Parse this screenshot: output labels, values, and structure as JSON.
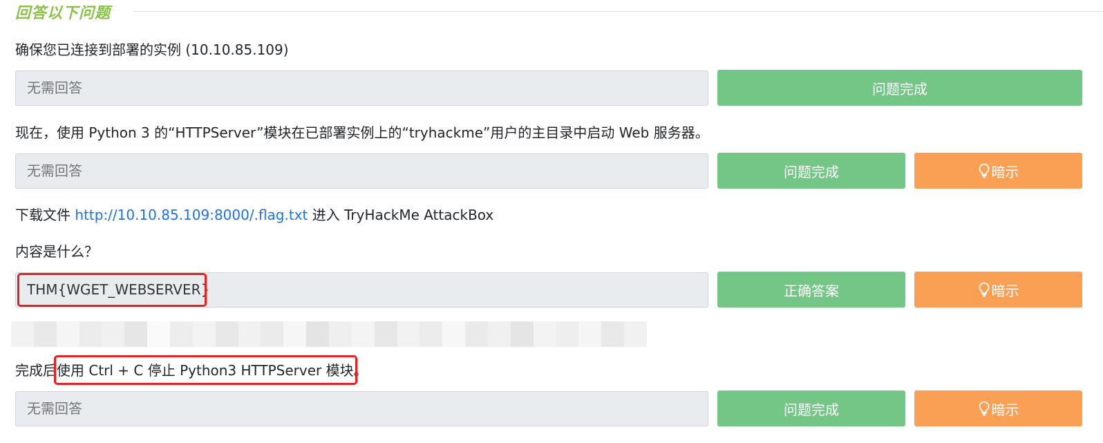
{
  "section": {
    "title": "回答以下问题"
  },
  "questions": [
    {
      "text": "确保您已连接到部署的实例 (10.10.85.109)",
      "answer": "无需回答",
      "button": "问题完成"
    },
    {
      "text": "现在，使用 Python 3 的“HTTPServer”模块在已部署实例上的“tryhackme”用户的主目录中启动 Web 服务器。",
      "answer": "无需回答",
      "button": "问题完成",
      "hint": "暗示"
    },
    {
      "text_prefix": "下载文件 ",
      "link": "http://10.10.85.109:8000/.flag.txt",
      "text_suffix": " 进入 TryHackMe AttackBox",
      "text_line2": "内容是什么？",
      "answer": "THM{WGET_WEBSERVER}",
      "button": "正确答案",
      "hint": "暗示"
    },
    {
      "text_prefix": "完成后",
      "text_boxed": "使用 Ctrl + C 停止 Python3 HTTPServer 模块。",
      "answer": "无需回答",
      "button": "问题完成",
      "hint": "暗示"
    }
  ],
  "colors": {
    "title_green": "#8bc34a",
    "button_green": "#74c686",
    "button_orange": "#faa055",
    "link_blue": "#1a73e8",
    "highlight_red": "#e8201f"
  },
  "icons": {
    "hint": "lightbulb-icon"
  }
}
